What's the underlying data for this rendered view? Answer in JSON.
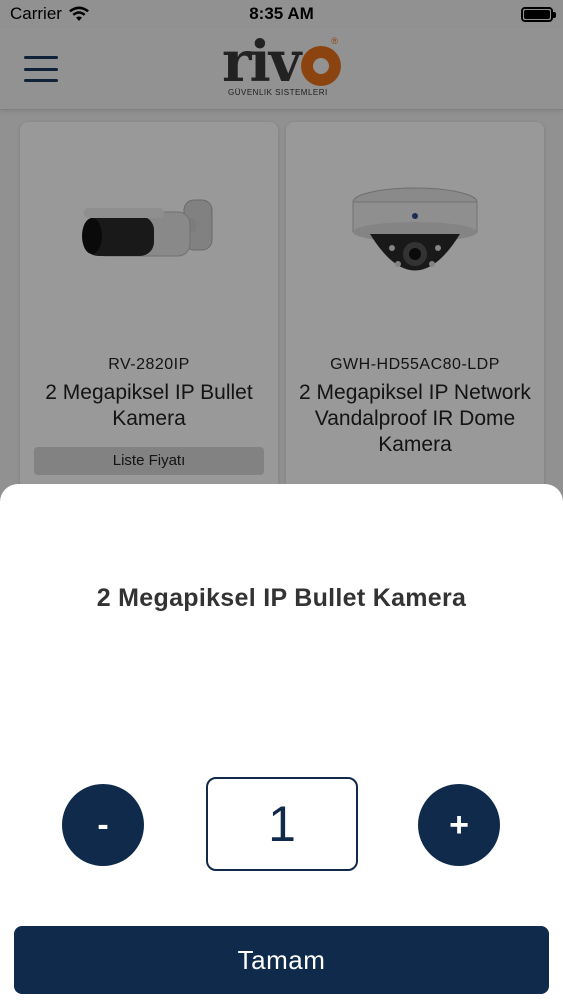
{
  "status_bar": {
    "carrier": "Carrier",
    "time": "8:35 AM"
  },
  "header": {
    "logo_text": "rivo",
    "logo_subtitle": "GÜVENLIK SISTEMLERI",
    "logo_mark": "®"
  },
  "products": [
    {
      "code": "RV-2820IP",
      "title": "2 Megapiksel IP Bullet Kamera",
      "price_label": "Liste Fiyatı",
      "icon": "bullet-camera-icon"
    },
    {
      "code": "GWH-HD55AC80-LDP",
      "title": "2 Megapiksel IP Network Vandalproof IR Dome Kamera",
      "icon": "dome-camera-icon"
    }
  ],
  "sheet": {
    "title": "2 Megapiksel IP Bullet Kamera",
    "minus_label": "-",
    "plus_label": "+",
    "quantity": "1",
    "confirm_label": "Tamam"
  },
  "colors": {
    "primary": "#0f2a4a",
    "accent": "#e8711c"
  }
}
